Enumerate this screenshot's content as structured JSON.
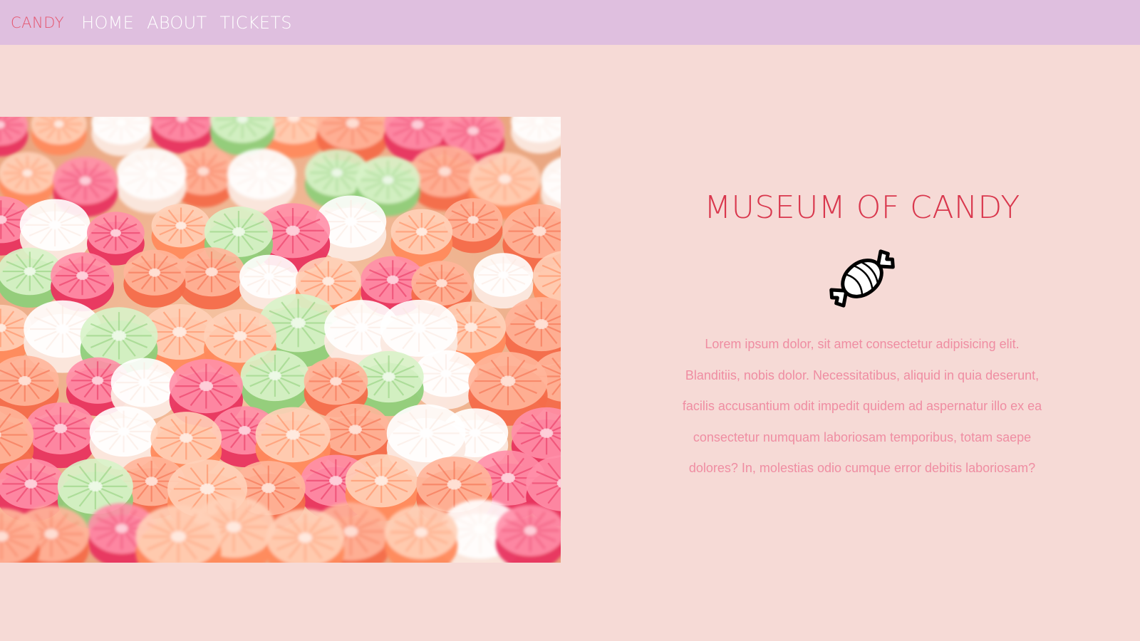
{
  "nav": {
    "brand": "CANDY",
    "links": [
      "HOME",
      "ABOUT",
      "TICKETS"
    ]
  },
  "hero": {
    "image_icon": "candy-photo"
  },
  "info": {
    "title": "MUSEUM OF CANDY",
    "icon": "wrapped-candy-icon",
    "lines": [
      "Lorem ipsum dolor, sit amet consectetur adipisicing elit.",
      "Blanditiis, nobis dolor. Necessitatibus, aliquid in quia deserunt,",
      "facilis accusantium odit impedit quidem ad aspernatur illo ex ea",
      "consectetur numquam laboriosam temporibus, totam saepe",
      "dolores? In, molestias odio cumque error debitis laboriosam?"
    ]
  },
  "colors": {
    "background": "#f6dad6",
    "navbar": "#dfbfdf",
    "brand": "#e5566f",
    "title": "#d9374d",
    "text": "#ef8da2"
  }
}
